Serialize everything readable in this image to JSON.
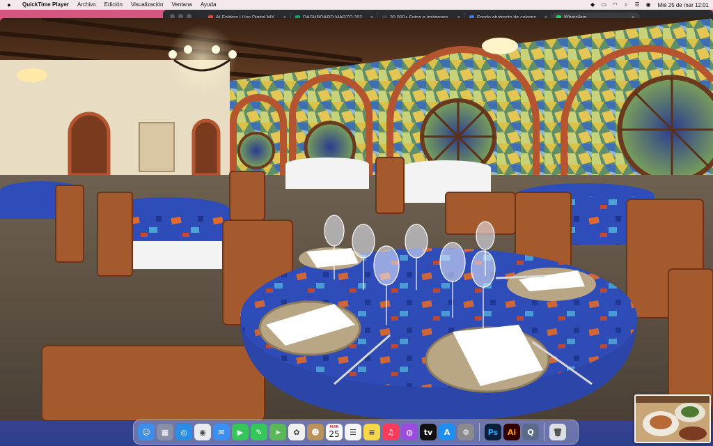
{
  "menubar": {
    "app_name": "QuickTime Player",
    "items": [
      "Archivo",
      "Edición",
      "Visualización",
      "Ventana",
      "Ayuda"
    ],
    "clock": "Mié 25 de mar  12:01",
    "status_icons": [
      "dropbox-icon",
      "battery-icon",
      "wifi-icon",
      "search-icon",
      "control-center-icon",
      "siri-icon"
    ]
  },
  "browser": {
    "tabs": [
      {
        "label": "AI Folders | Uso Digital MX",
        "color": "#e34a3b"
      },
      {
        "label": "DASHBOARD MARZO 2022 - Hoja",
        "color": "#1fa463"
      },
      {
        "label": "30.000+ Fotos e Imágenes de",
        "color": "#444444"
      },
      {
        "label": "Fondo abstracto de colores",
        "color": "#3b7be0"
      },
      {
        "label": "WhatsApp",
        "color": "#25d366",
        "active": true
      }
    ]
  },
  "video": {
    "scene": "restaurant-dining-room",
    "colors": {
      "tablecloth": "#2f4db8",
      "wood": "#a45a2c",
      "brick": "#b45a3a"
    }
  },
  "dock": {
    "apps": [
      {
        "name": "finder",
        "color": "#3d8ee8",
        "glyph": "☺"
      },
      {
        "name": "launchpad",
        "color": "#8a8fa8",
        "glyph": "▦"
      },
      {
        "name": "safari",
        "color": "#2a8de3",
        "glyph": "◎"
      },
      {
        "name": "chrome",
        "color": "#e9ecef",
        "glyph": "◉"
      },
      {
        "name": "mail",
        "color": "#3a8ff0",
        "glyph": "✉"
      },
      {
        "name": "facetime",
        "color": "#35c759",
        "glyph": "▶"
      },
      {
        "name": "messages",
        "color": "#34c759",
        "glyph": "✎"
      },
      {
        "name": "maps",
        "color": "#5ab859",
        "glyph": "➤"
      },
      {
        "name": "photos",
        "color": "#f0f0f0",
        "glyph": "✿"
      },
      {
        "name": "contacts",
        "color": "#b8925a",
        "glyph": "☻"
      },
      {
        "name": "calendar",
        "color": "#ffffff",
        "glyph": ""
      },
      {
        "name": "reminders",
        "color": "#f4f4f4",
        "glyph": "☰"
      },
      {
        "name": "notes",
        "color": "#f6d64a",
        "glyph": "≡"
      },
      {
        "name": "music",
        "color": "#fa3b5a",
        "glyph": "♫"
      },
      {
        "name": "podcasts",
        "color": "#9b4bde",
        "glyph": "◍"
      },
      {
        "name": "tv",
        "color": "#111111",
        "glyph": "tv"
      },
      {
        "name": "app-store",
        "color": "#1f8ef1",
        "glyph": "A"
      },
      {
        "name": "system-preferences",
        "color": "#8a8a8f",
        "glyph": "⚙"
      }
    ],
    "calendar": {
      "month": "MAR",
      "day": "25"
    },
    "pinned": [
      {
        "name": "photoshop",
        "color": "#0b1e3a",
        "glyph": "Ps",
        "text_color": "#31a8ff"
      },
      {
        "name": "illustrator",
        "color": "#330000",
        "glyph": "Ai",
        "text_color": "#ff9a00"
      },
      {
        "name": "quicktime",
        "color": "#5a6b8a",
        "glyph": "Q",
        "text_color": "#ffffff"
      }
    ],
    "trash": {
      "name": "trash",
      "color": "#dcdfe4",
      "glyph": "🗑"
    }
  }
}
